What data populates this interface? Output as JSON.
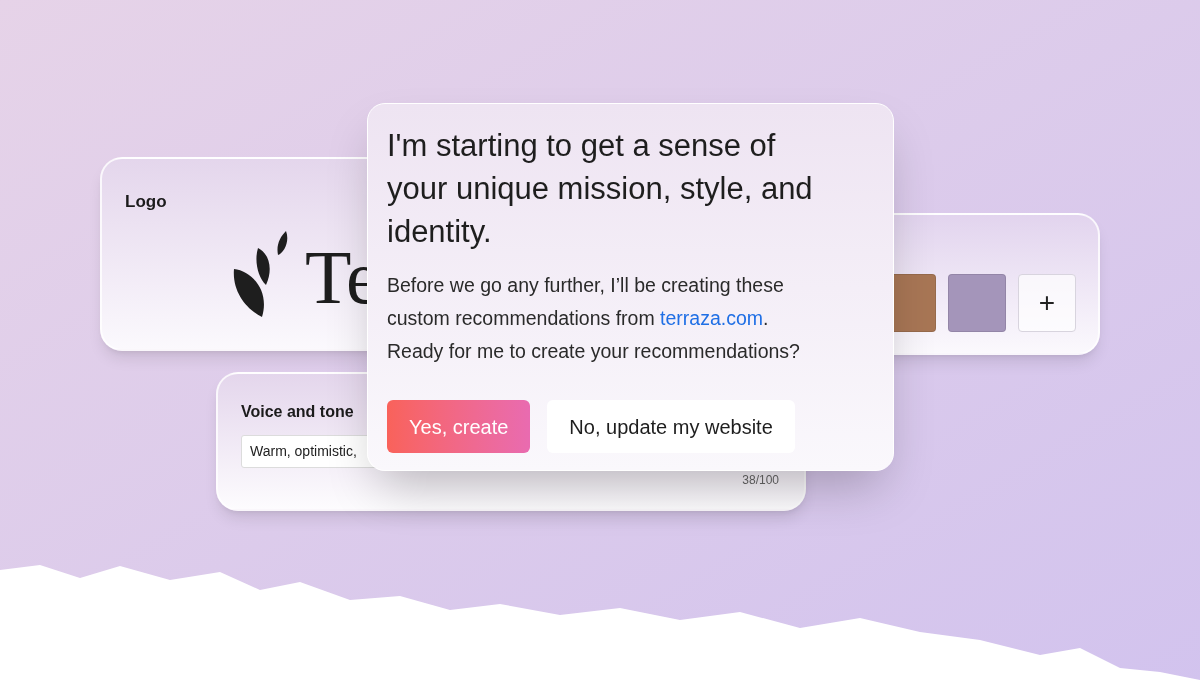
{
  "logo_card": {
    "title": "Logo",
    "wordmark": "Te"
  },
  "colors_card": {
    "swatches": [
      {
        "color": "#a87655"
      },
      {
        "color": "#a495ba"
      }
    ],
    "add_button": "+"
  },
  "voice_card": {
    "title": "Voice and tone",
    "value": "Warm, optimistic,",
    "count": "38/100"
  },
  "dialog": {
    "heading": "I'm starting to get a sense of your unique mission, style, and identity.",
    "body_before": "Before we go any further, I’ll be creating these custom recommendations from ",
    "link": "terraza.com",
    "body_after": ". Ready for me to create your recommendations?",
    "buttons": [
      {
        "label": "Yes, create",
        "kind": "primary"
      },
      {
        "label": "No, update my website",
        "kind": "secondary"
      }
    ]
  }
}
